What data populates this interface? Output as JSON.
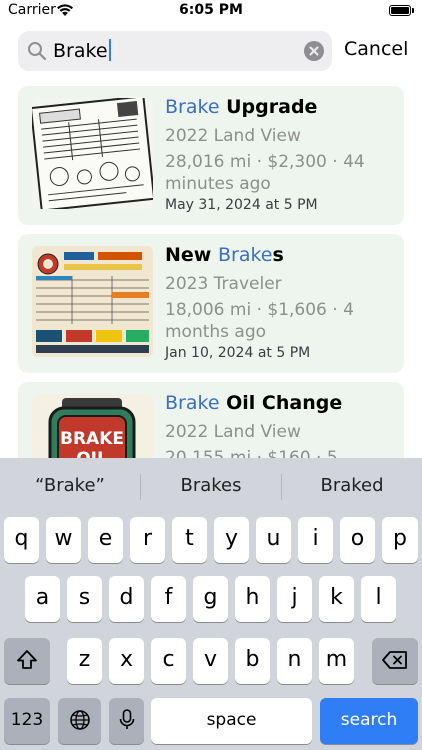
{
  "status_bar": {
    "carrier": "Carrier",
    "time": "6:05 PM"
  },
  "search": {
    "query": "Brake",
    "cancel_label": "Cancel"
  },
  "results": [
    {
      "title_highlight": "Brake",
      "title_rest": " Upgrade",
      "title_prefix": "",
      "vehicle": "2022 Land View",
      "meta": "28,016 mi · $2,300 · 44 minutes ago",
      "date": "May 31, 2024 at 5 PM"
    },
    {
      "title_prefix": "New ",
      "title_highlight": "Brake",
      "title_rest": "s",
      "vehicle": "2023 Traveler",
      "meta": "18,006 mi · $1,606 · 4 months ago",
      "date": "Jan 10, 2024 at 5 PM"
    },
    {
      "title_prefix": "",
      "title_highlight": "Brake",
      "title_rest": " Oil Change",
      "vehicle": "2022 Land View",
      "meta": "20,155 mi · $160 · 5",
      "date": ""
    }
  ],
  "thumb_text": {
    "brake_oil_line1": "BRAKE",
    "brake_oil_line2": "OIL"
  },
  "keyboard": {
    "suggestions": [
      "“Brake”",
      "Brakes",
      "Braked"
    ],
    "row1": [
      "q",
      "w",
      "e",
      "r",
      "t",
      "y",
      "u",
      "i",
      "o",
      "p"
    ],
    "row2": [
      "a",
      "s",
      "d",
      "f",
      "g",
      "h",
      "j",
      "k",
      "l"
    ],
    "row3": [
      "z",
      "x",
      "c",
      "v",
      "b",
      "n",
      "m"
    ],
    "numbers_label": "123",
    "space_label": "space",
    "search_label": "search"
  },
  "colors": {
    "accent": "#2f7ef6",
    "highlight": "#3b6fc4",
    "card_bg": "#eef5ef",
    "keyboard_bg": "#d1d4db"
  }
}
